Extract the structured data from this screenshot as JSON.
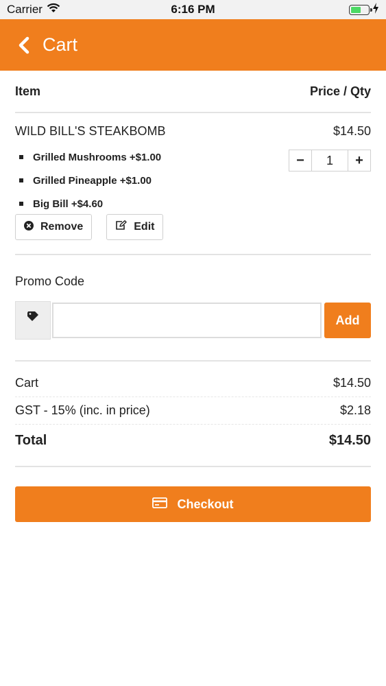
{
  "status_bar": {
    "carrier": "Carrier",
    "time": "6:16 PM",
    "battery_level": 0.6,
    "battery_color": "#4cd964"
  },
  "header": {
    "title": "Cart",
    "back_icon": "chevron-left-icon",
    "background": "#f07e1d"
  },
  "cart_table": {
    "col_item": "Item",
    "col_price_qty": "Price / Qty"
  },
  "items": [
    {
      "name": "WILD BILL'S STEAKBOMB",
      "price": "$14.50",
      "quantity": "1",
      "modifiers": [
        "Grilled Mushrooms +$1.00",
        "Grilled Pineapple +$1.00",
        "Big Bill +$4.60"
      ],
      "minus_label": "−",
      "plus_label": "+",
      "remove_label": "Remove",
      "edit_label": "Edit"
    }
  ],
  "promo": {
    "label": "Promo Code",
    "input_value": "",
    "placeholder": "",
    "add_label": "Add",
    "tag_icon": "tag-icon"
  },
  "summary": {
    "cart_label": "Cart",
    "cart_value": "$14.50",
    "gst_label": "GST - 15% (inc. in price)",
    "gst_value": "$2.18",
    "total_label": "Total",
    "total_value": "$14.50"
  },
  "checkout": {
    "label": "Checkout",
    "icon": "credit-card-icon"
  }
}
